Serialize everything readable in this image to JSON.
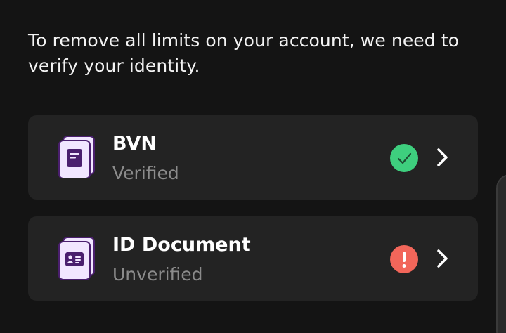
{
  "intro": {
    "text": "To remove all limits on your account, we need to verify your identity."
  },
  "items": [
    {
      "title": "BVN",
      "status": "Verified",
      "status_kind": "verified",
      "icon": "document-icon",
      "badge_icon": "check-icon",
      "badge_color": "#3ecf7e"
    },
    {
      "title": "ID Document",
      "status": "Unverified",
      "status_kind": "unverified",
      "icon": "id-card-icon",
      "badge_icon": "exclamation-icon",
      "badge_color": "#f2665a"
    }
  ],
  "colors": {
    "background": "#141414",
    "card": "#232323",
    "icon_fill": "#f1e6ff",
    "icon_accent": "#4a1f6e",
    "muted_text": "#8b8b8b"
  }
}
